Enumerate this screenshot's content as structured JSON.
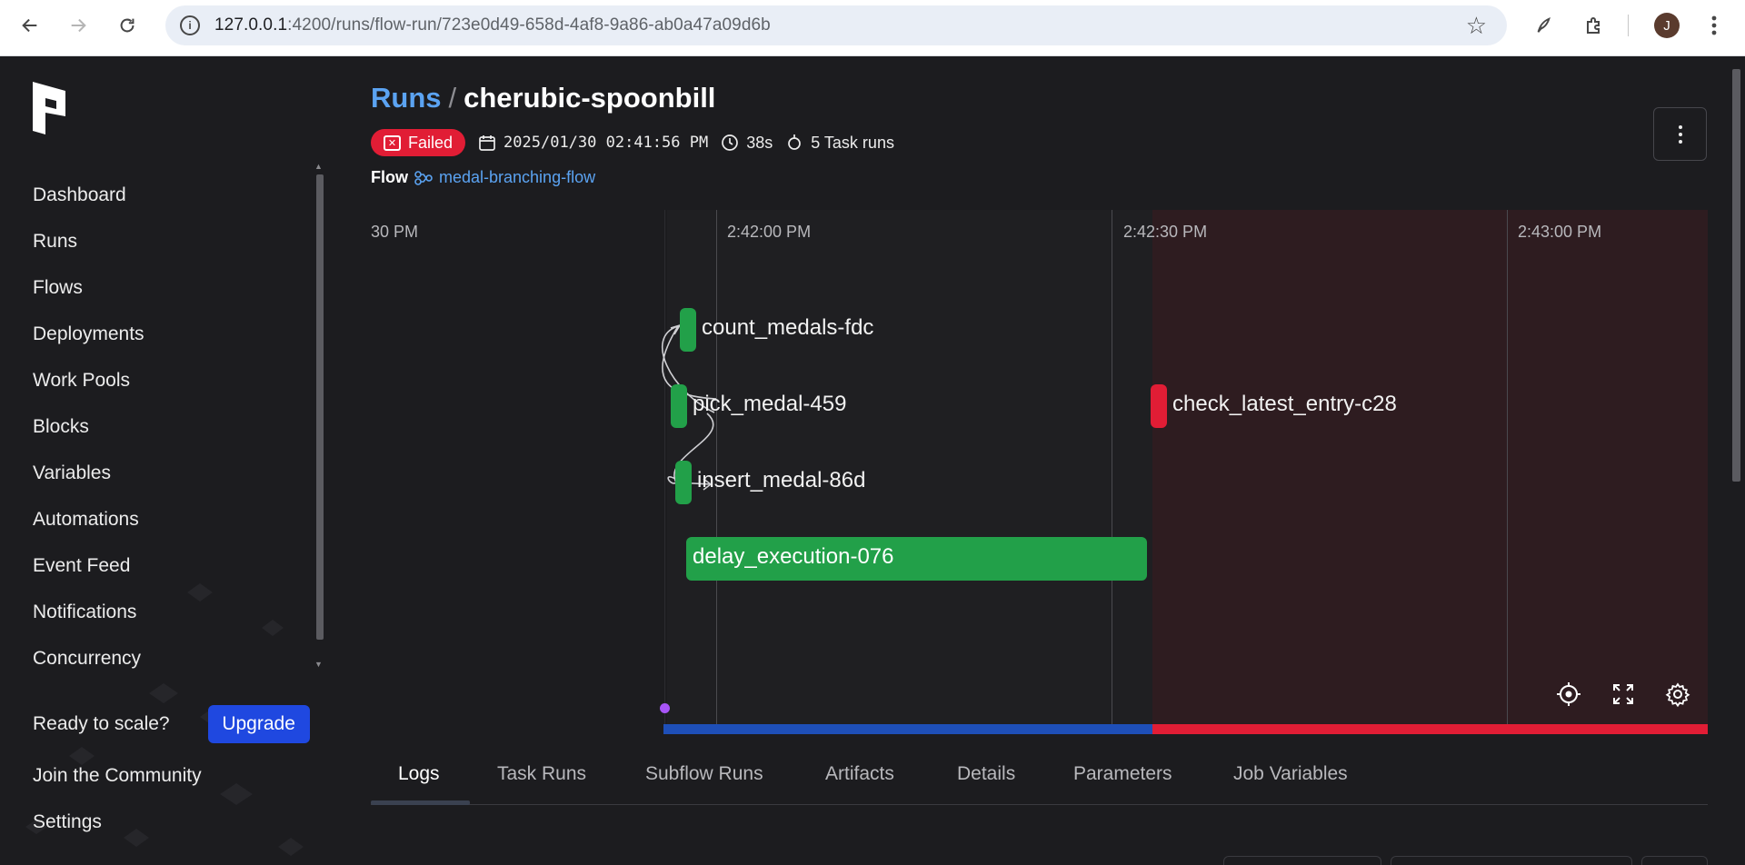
{
  "browser": {
    "url_host": "127.0.0.1",
    "url_rest": ":4200/runs/flow-run/723e0d49-658d-4af8-9a86-ab0a47a09d6b",
    "avatar_letter": "J"
  },
  "sidebar": {
    "items": [
      {
        "label": "Dashboard"
      },
      {
        "label": "Runs"
      },
      {
        "label": "Flows"
      },
      {
        "label": "Deployments"
      },
      {
        "label": "Work Pools"
      },
      {
        "label": "Blocks"
      },
      {
        "label": "Variables"
      },
      {
        "label": "Automations"
      },
      {
        "label": "Event Feed"
      },
      {
        "label": "Notifications"
      },
      {
        "label": "Concurrency"
      }
    ],
    "upgrade_prompt": "Ready to scale?",
    "upgrade_button": "Upgrade",
    "community_link": "Join the Community",
    "settings_link": "Settings"
  },
  "header": {
    "breadcrumb_parent": "Runs",
    "breadcrumb_separator": "/",
    "title": "cherubic-spoonbill",
    "state": "Failed",
    "start_time": "2025/01/30 02:41:56 PM",
    "duration": "38s",
    "task_runs": "5 Task runs",
    "flow_label": "Flow",
    "flow_name": "medal-branching-flow"
  },
  "timeline": {
    "time_labels": [
      "30 PM",
      "2:42:00 PM",
      "2:42:30 PM",
      "2:43:00 PM"
    ],
    "tasks": [
      {
        "name": "count_medals-fdc",
        "state": "Completed"
      },
      {
        "name": "pick_medal-459",
        "state": "Completed"
      },
      {
        "name": "insert_medal-86d",
        "state": "Completed"
      },
      {
        "name": "delay_execution-076",
        "state": "Completed"
      },
      {
        "name": "check_latest_entry-c28",
        "state": "Failed"
      }
    ],
    "colors": {
      "completed": "#22a049",
      "failed": "#e11d35",
      "running_track": "#1e4fb8",
      "event_dot": "#a855f7"
    }
  },
  "tabs": [
    {
      "label": "Logs"
    },
    {
      "label": "Task Runs"
    },
    {
      "label": "Subflow Runs"
    },
    {
      "label": "Artifacts"
    },
    {
      "label": "Details"
    },
    {
      "label": "Parameters"
    },
    {
      "label": "Job Variables"
    }
  ]
}
